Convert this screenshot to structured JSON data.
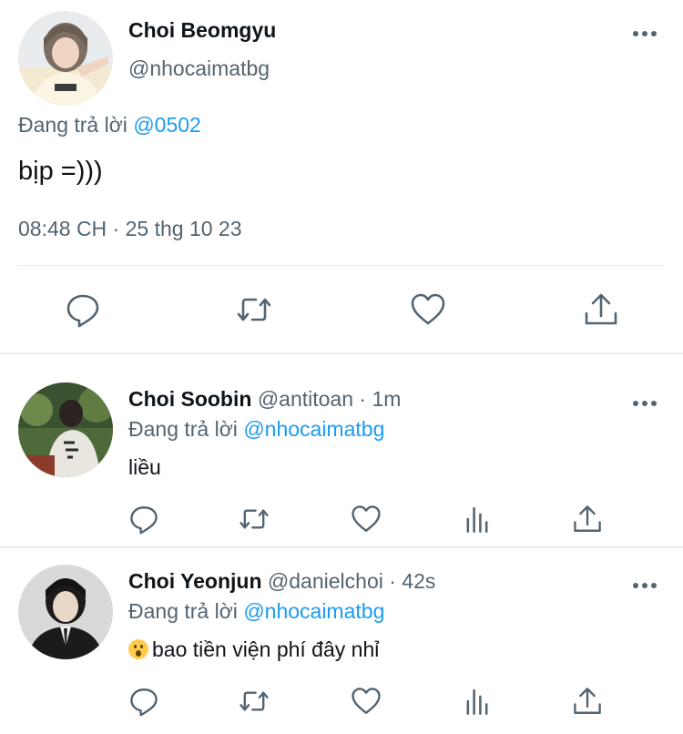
{
  "main_tweet": {
    "author_name": "Choi Beomgyu",
    "handle": "@nhocaimatbg",
    "reply_prefix": "Đang trả lời",
    "reply_to": "@0502",
    "text": "bịp =)))",
    "timestamp": "08:48 CH · 25 thg 10 23",
    "actions": [
      "reply-icon",
      "retweet-icon",
      "like-icon",
      "share-icon"
    ]
  },
  "replies": [
    {
      "author_name": "Choi Soobin",
      "handle": "@antitoan",
      "time": " · 1m",
      "reply_prefix": "Đang trả lời",
      "reply_to": "@nhocaimatbg",
      "text": "liều",
      "actions": [
        "reply-icon",
        "retweet-icon",
        "like-icon",
        "views-icon",
        "share-icon"
      ]
    },
    {
      "author_name": "Choi Yeonjun",
      "handle": "@danielchoi",
      "time": " · 42s",
      "reply_prefix": "Đang trả lời",
      "reply_to": "@nhocaimatbg",
      "emoji": "hushed-face",
      "text": "bao tiền viện phí đây nhỉ",
      "actions": [
        "reply-icon",
        "retweet-icon",
        "like-icon",
        "views-icon",
        "share-icon"
      ]
    }
  ],
  "colors": {
    "text": "#0f1419",
    "secondary": "#536471",
    "link": "#1d9bf0",
    "divider": "#e6ecf0"
  }
}
